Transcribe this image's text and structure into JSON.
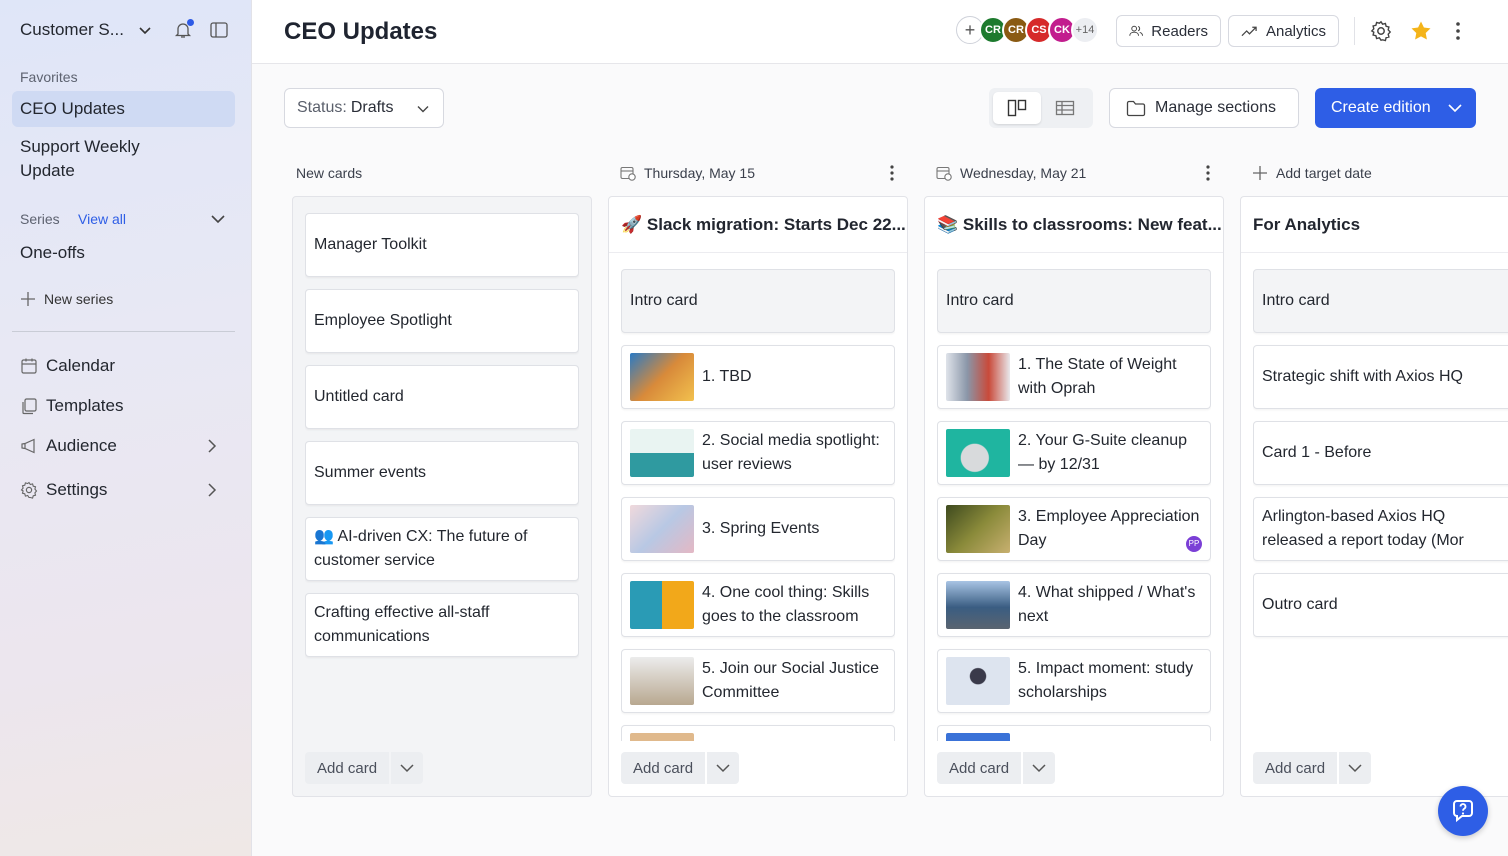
{
  "sidebar": {
    "workspace": "Customer S...",
    "favorites_label": "Favorites",
    "favorites": [
      {
        "label": "CEO Updates",
        "active": true
      },
      {
        "label": "Support Weekly Update",
        "active": false
      }
    ],
    "series_label": "Series",
    "series_view_all": "View all",
    "series": [
      {
        "label": "One-offs"
      }
    ],
    "new_series": "New series",
    "nav": [
      {
        "label": "Calendar",
        "icon": "calendar-icon"
      },
      {
        "label": "Templates",
        "icon": "templates-icon"
      },
      {
        "label": "Audience",
        "icon": "megaphone-icon"
      },
      {
        "label": "Settings",
        "icon": "gear-icon"
      }
    ]
  },
  "header": {
    "title": "CEO Updates",
    "avatars": [
      {
        "initials": "CR",
        "color": "#1d7a2e"
      },
      {
        "initials": "CR",
        "color": "#8a5a12"
      },
      {
        "initials": "CS",
        "color": "#d62a2a"
      },
      {
        "initials": "CK",
        "color": "#c21d8e"
      }
    ],
    "avatars_more": "+14",
    "readers_label": "Readers",
    "analytics_label": "Analytics"
  },
  "toolbar": {
    "status_prefix": "Status:",
    "status_value": "Drafts",
    "manage_sections": "Manage sections",
    "create_edition": "Create edition"
  },
  "board": {
    "new_cards_label": "New cards",
    "add_target_date": "Add target date",
    "add_card": "Add card",
    "columns": [
      {
        "header": "New cards",
        "cards": [
          {
            "text": "Manager Toolkit"
          },
          {
            "text": "Employee Spotlight"
          },
          {
            "text": "Untitled card"
          },
          {
            "text": "Summer events"
          },
          {
            "text": "👥 AI-driven CX: The future of customer service"
          },
          {
            "text": "Crafting effective all-staff communications"
          }
        ]
      },
      {
        "header": "Thursday, May 15",
        "title": "🚀 Slack migration: Starts Dec 22...",
        "cards": [
          {
            "text": "Intro card",
            "intro": true
          },
          {
            "text": "1. TBD",
            "thumb": "#d4883a"
          },
          {
            "text": "2. Social media spotlight: user reviews",
            "thumb": "#2f9aa0"
          },
          {
            "text": "3. Spring Events",
            "thumb": "#e2c4c8"
          },
          {
            "text": "4. One cool thing: Skills goes to the classroom",
            "thumb": "#2a9bb5"
          },
          {
            "text": "5. Join our Social Justice Committee",
            "thumb": "#c9c2b8"
          },
          {
            "text": "",
            "thumb": "#e0b98c"
          }
        ]
      },
      {
        "header": "Wednesday, May 21",
        "title": "📚 Skills to classrooms: New feat...",
        "cards": [
          {
            "text": "Intro card",
            "intro": true
          },
          {
            "text": "1. The State of Weight with Oprah",
            "thumb": "#c9cdd4"
          },
          {
            "text": "2. Your G-Suite cleanup — by 12/31",
            "thumb": "#1fb5a0"
          },
          {
            "text": "3. Employee Appreciation Day",
            "thumb": "#5d6b2a",
            "badge": "PP"
          },
          {
            "text": "4. What shipped / What's next",
            "thumb": "#3a5d82"
          },
          {
            "text": "5. Impact moment: study scholarships",
            "thumb": "#dde4ef"
          },
          {
            "text": "",
            "thumb": "#3a72d8"
          }
        ]
      },
      {
        "header": "Add target date",
        "title": "For Analytics",
        "cards": [
          {
            "text": "Intro card",
            "intro": true
          },
          {
            "text": "Strategic shift with Axios HQ"
          },
          {
            "text": "Card 1 - Before"
          },
          {
            "text": "Arlington-based Axios HQ released a report today (Mor"
          },
          {
            "text": "Outro card"
          }
        ]
      }
    ]
  }
}
